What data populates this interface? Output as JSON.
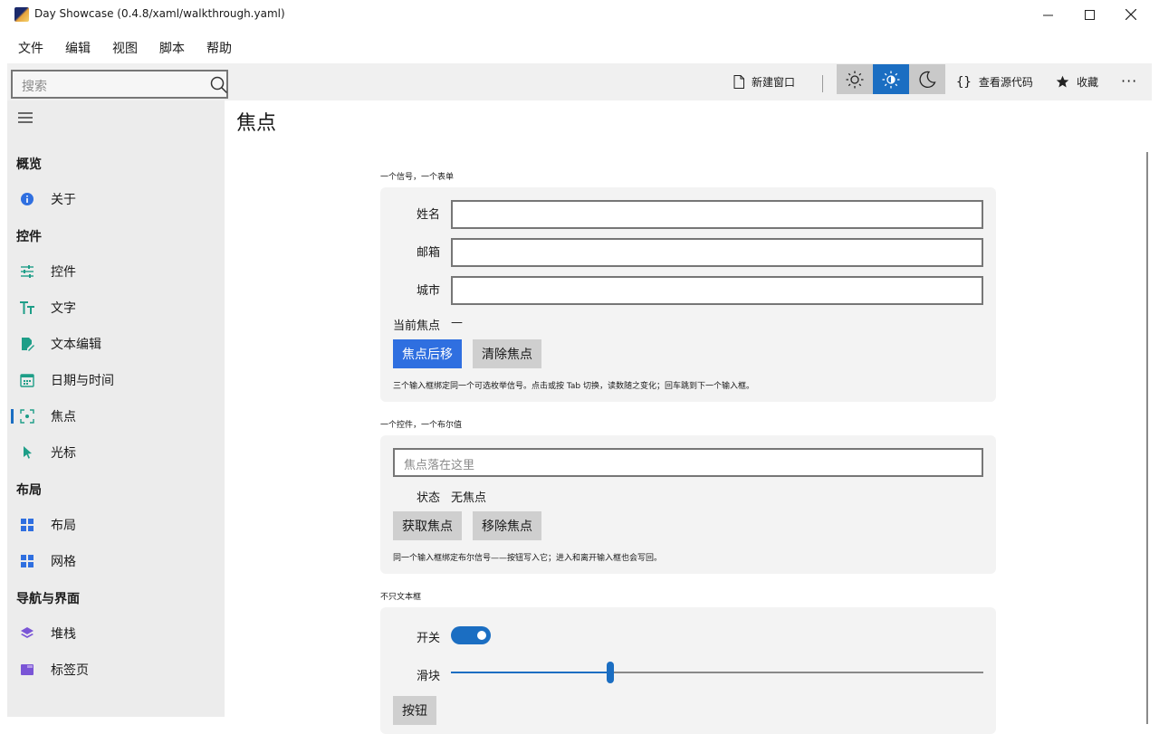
{
  "window": {
    "title": "Day Showcase (0.4.8/xaml/walkthrough.yaml)",
    "minimize": "—",
    "maximize": "☐",
    "close": "✕"
  },
  "menu": [
    "文件",
    "编辑",
    "视图",
    "脚本",
    "帮助"
  ],
  "toolbar": {
    "search_placeholder": "搜索",
    "new_window": "新建窗口",
    "view_source": "查看源代码",
    "favorite": "收藏",
    "more": "···",
    "theme_buttons": [
      "light",
      "auto",
      "dark"
    ],
    "active_theme": "auto"
  },
  "sidebar": {
    "sections": [
      {
        "title": "概览",
        "items": [
          {
            "label": "关于",
            "icon": "info-icon"
          }
        ]
      },
      {
        "title": "控件",
        "items": [
          {
            "label": "控件",
            "icon": "sliders-icon"
          },
          {
            "label": "文字",
            "icon": "text-icon"
          },
          {
            "label": "文本编辑",
            "icon": "edit-icon"
          },
          {
            "label": "日期与时间",
            "icon": "calendar-icon"
          },
          {
            "label": "焦点",
            "icon": "focus-icon"
          },
          {
            "label": "光标",
            "icon": "cursor-icon"
          }
        ]
      },
      {
        "title": "布局",
        "items": [
          {
            "label": "布局",
            "icon": "layout-icon"
          },
          {
            "label": "网格",
            "icon": "grid-icon"
          }
        ]
      },
      {
        "title": "导航与界面",
        "items": [
          {
            "label": "堆栈",
            "icon": "stack-icon"
          },
          {
            "label": "标签页",
            "icon": "tabs-icon"
          }
        ]
      }
    ],
    "active_item": "焦点"
  },
  "page": {
    "title": "焦点",
    "group1": {
      "caption": "一个信号，一个表单",
      "fields": [
        {
          "label": "姓名",
          "value": ""
        },
        {
          "label": "邮箱",
          "value": ""
        },
        {
          "label": "城市",
          "value": ""
        }
      ],
      "current_focus_label": "当前焦点",
      "current_focus_value": "—",
      "next_button": "焦点后移",
      "clear_button": "清除焦点",
      "note": "三个输入框绑定同一个可选枚举信号。点击或按 Tab 切换，读数随之变化；回车跳到下一个输入框。"
    },
    "group2": {
      "caption": "一个控件，一个布尔值",
      "input_placeholder": "焦点落在这里",
      "status_label": "状态",
      "status_value": "无焦点",
      "acquire_button": "获取焦点",
      "remove_button": "移除焦点",
      "note": "同一个输入框绑定布尔信号——按钮写入它；进入和离开输入框也会写回。"
    },
    "group3": {
      "caption": "不只文本框",
      "switch_label": "开关",
      "switch_on": true,
      "slider_label": "滑块",
      "slider_value_fraction": 0.3,
      "button_label": "按钮"
    }
  },
  "colors": {
    "accent": "#1b6ec2",
    "primary_button": "#2f6fe0",
    "sidebar_bg": "#ececec",
    "card_bg": "#f3f3f3"
  }
}
